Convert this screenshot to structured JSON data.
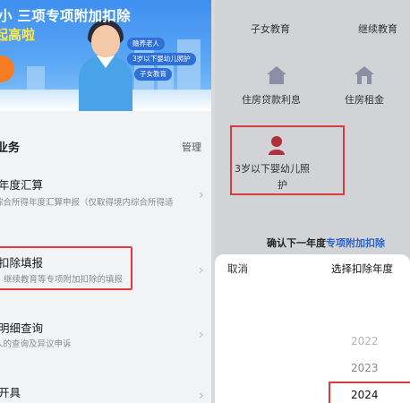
{
  "left": {
    "banner": {
      "title": "小 三项专项附加扣除",
      "subtitle": "起高啦",
      "tags": [
        "赡养老人",
        "3岁以下婴幼儿照护",
        "子女教育"
      ]
    },
    "section_title": "业务",
    "manage_label": "管理",
    "items": [
      {
        "title": "年度汇算",
        "desc": "综合所得年度汇算申报（仅取得境内综合所得适"
      },
      {
        "title": "扣除填报",
        "desc": "继续教育等专项附加扣除的填报"
      },
      {
        "title": "明细查询",
        "desc": "人的查询及异议申诉"
      },
      {
        "title": "开具",
        "desc": ""
      }
    ]
  },
  "right": {
    "grid": [
      {
        "label": "子女教育",
        "icon": "child-education-icon"
      },
      {
        "label": "继续教育",
        "icon": "continuing-education-icon"
      },
      {
        "label": "住房贷款利息",
        "icon": "house-loan-icon"
      },
      {
        "label": "住房租金",
        "icon": "house-rent-icon"
      },
      {
        "label_line1": "3岁以下婴幼儿照",
        "label_line2": "护",
        "icon": "infant-care-icon"
      }
    ],
    "confirm_prefix": "确认下一年度",
    "confirm_link": "专项附加扣除",
    "sheet": {
      "cancel": "取消",
      "title": "选择扣除年度",
      "years": [
        "2022",
        "2023",
        "2024"
      ],
      "selected_year": "2024"
    }
  },
  "colors": {
    "highlight": "#e33a3a",
    "link": "#2a62d6",
    "banner": "#3f8ff0"
  }
}
